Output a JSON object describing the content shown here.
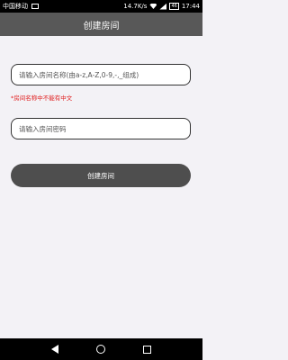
{
  "status_bar": {
    "carrier": "中国移动",
    "speed": "14.7K/s",
    "battery": "46",
    "time": "17:44"
  },
  "title_bar": {
    "title": "创建房间"
  },
  "form": {
    "room_name_placeholder": "请输入房间名称(由a-z,A-Z,0-9,-,_组成)",
    "room_name_value": "",
    "warning": "*房间名称中不能有中文",
    "password_placeholder": "请输入房间密码",
    "password_value": "",
    "create_button": "创建房间"
  },
  "nav_bar": {
    "back_icon": "back-triangle",
    "home_icon": "home-circle",
    "recent_icon": "recent-square"
  }
}
